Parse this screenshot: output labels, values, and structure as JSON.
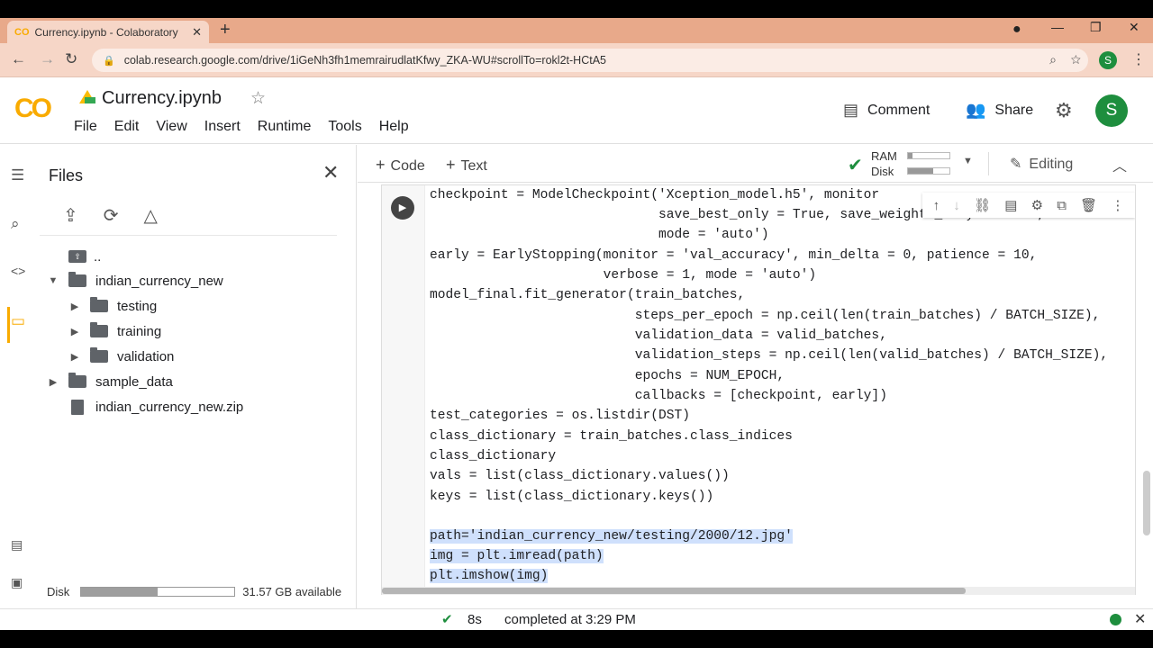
{
  "browser": {
    "tab_title": "Currency.ipynb - Colaboratory",
    "tab_logo": "CO",
    "url": "colab.research.google.com/drive/1iGeNh3fh1memrairudlatKfwy_ZKA-WU#scrollTo=rokl2t-HCtA5",
    "profile_initial": "S"
  },
  "header": {
    "logo": "CO",
    "notebook_title": "Currency.ipynb",
    "menu": [
      "File",
      "Edit",
      "View",
      "Insert",
      "Runtime",
      "Tools",
      "Help"
    ],
    "comment_label": "Comment",
    "share_label": "Share",
    "avatar_initial": "S"
  },
  "files_panel": {
    "title": "Files",
    "tree": [
      {
        "label": "..",
        "kind": "up"
      },
      {
        "label": "indian_currency_new",
        "kind": "folder-open"
      },
      {
        "label": "testing",
        "kind": "folder"
      },
      {
        "label": "training",
        "kind": "folder"
      },
      {
        "label": "validation",
        "kind": "folder"
      },
      {
        "label": "sample_data",
        "kind": "folder"
      },
      {
        "label": "indian_currency_new.zip",
        "kind": "file"
      }
    ],
    "disk_label": "Disk",
    "disk_available": "31.57 GB available",
    "disk_used_fraction": 0.5
  },
  "toolbar": {
    "code_label": "Code",
    "text_label": "Text",
    "ram_label": "RAM",
    "disk_label": "Disk",
    "ram_used_fraction": 0.1,
    "disk_used_fraction": 0.6,
    "editing_label": "Editing"
  },
  "code_lines": [
    "checkpoint = ModelCheckpoint('Xception_model.h5', monitor",
    "                             save_best_only = True, save_weights_only = False,",
    "                             mode = 'auto')",
    "early = EarlyStopping(monitor = 'val_accuracy', min_delta = 0, patience = 10,",
    "                      verbose = 1, mode = 'auto')",
    "model_final.fit_generator(train_batches,",
    "                          steps_per_epoch = np.ceil(len(train_batches) / BATCH_SIZE),",
    "                          validation_data = valid_batches,",
    "                          validation_steps = np.ceil(len(valid_batches) / BATCH_SIZE),",
    "                          epochs = NUM_EPOCH,",
    "                          callbacks = [checkpoint, early])",
    "test_categories = os.listdir(DST)",
    "class_dictionary = train_batches.class_indices",
    "class_dictionary",
    "vals = list(class_dictionary.values())",
    "keys = list(class_dictionary.keys())",
    "",
    "path='indian_currency_new/testing/2000/12.jpg'",
    "img = plt.imread(path)",
    "plt.imshow(img)"
  ],
  "status": {
    "duration": "8s",
    "message": "completed at 3:29 PM"
  }
}
